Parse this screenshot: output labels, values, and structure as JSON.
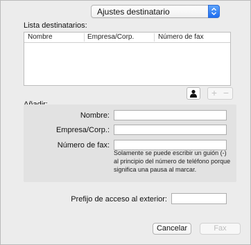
{
  "dropdown": {
    "selected": "Ajustes destinatario"
  },
  "recipients": {
    "label": "Lista destinatarios:",
    "columns": [
      "Nombre",
      "Empresa/Corp.",
      "Número de fax"
    ],
    "rows": []
  },
  "toolbar": {
    "add_symbol": "+",
    "remove_symbol": "−"
  },
  "add": {
    "label": "Añadir:",
    "name_label": "Nombre:",
    "name_value": "",
    "company_label": "Empresa/Corp.:",
    "company_value": "",
    "fax_label": "Número de fax:",
    "fax_value": "",
    "help": "Solamente se puede escribir un guión (-) al principio del número de teléfono porque significa una pausa al marcar."
  },
  "prefix": {
    "label": "Prefijo de acceso al exterior:",
    "value": ""
  },
  "buttons": {
    "cancel": "Cancelar",
    "fax": "Fax"
  },
  "icons": {
    "contacts": "person-icon",
    "dropdown": "stepper-arrows-icon"
  },
  "colors": {
    "accent": "#1e6df0"
  }
}
